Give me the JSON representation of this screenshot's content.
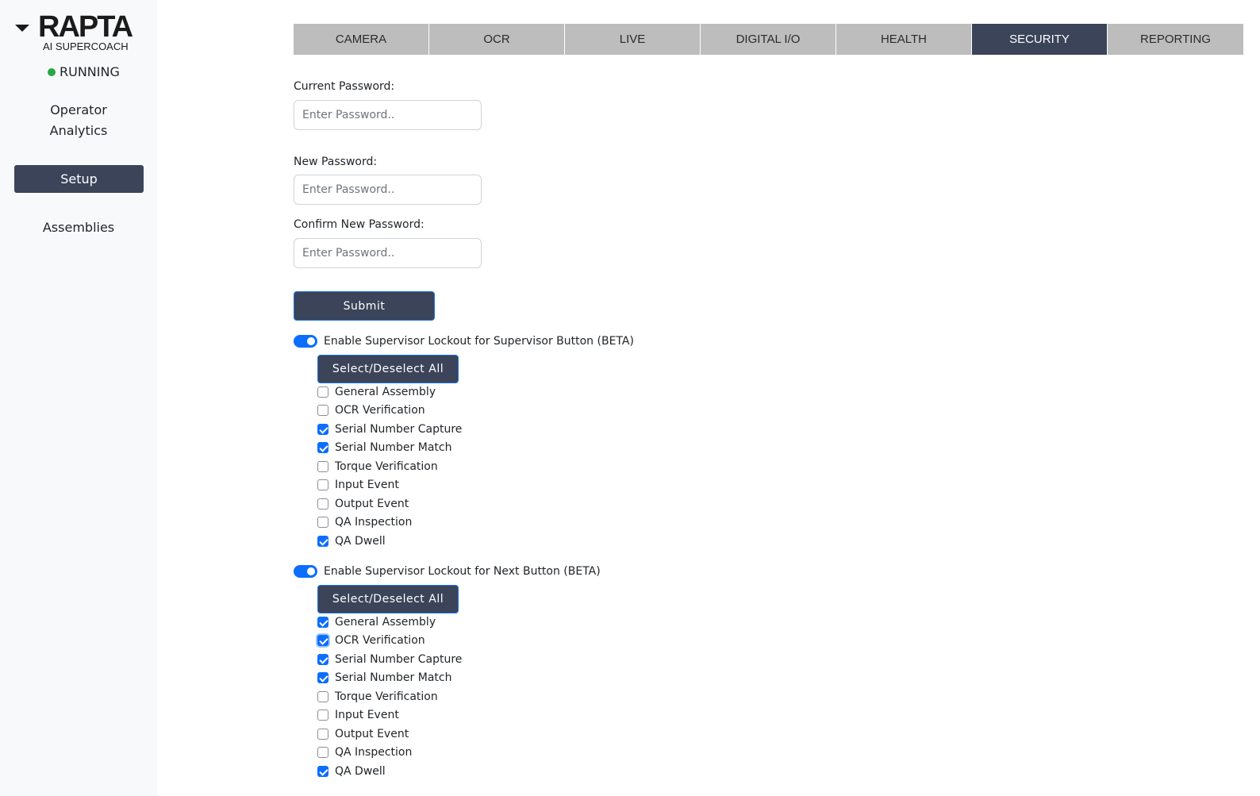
{
  "brand": {
    "logo": "RAPTA",
    "subtitle": "AI SUPERCOACH",
    "status": "RUNNING",
    "status_color": "#28a745"
  },
  "sidebar": {
    "operator_analytics_line1": "Operator",
    "operator_analytics_line2": "Analytics",
    "setup": "Setup",
    "assemblies": "Assemblies"
  },
  "tabs": [
    {
      "label": "CAMERA",
      "active": false
    },
    {
      "label": "OCR",
      "active": false
    },
    {
      "label": "LIVE",
      "active": false
    },
    {
      "label": "DIGITAL I/O",
      "active": false
    },
    {
      "label": "HEALTH",
      "active": false
    },
    {
      "label": "SECURITY",
      "active": true
    },
    {
      "label": "REPORTING",
      "active": false
    }
  ],
  "form": {
    "current_label": "Current Password:",
    "new_label": "New Password:",
    "confirm_label": "Confirm New Password:",
    "placeholder": "Enter Password..",
    "submit": "Submit"
  },
  "lockout_supervisor": {
    "enabled": true,
    "label": "Enable Supervisor Lockout for Supervisor Button (BETA)",
    "select_all": "Select/Deselect All",
    "items": [
      {
        "label": "General Assembly",
        "checked": false
      },
      {
        "label": "OCR Verification",
        "checked": false
      },
      {
        "label": "Serial Number Capture",
        "checked": true
      },
      {
        "label": "Serial Number Match",
        "checked": true
      },
      {
        "label": "Torque Verification",
        "checked": false
      },
      {
        "label": "Input Event",
        "checked": false
      },
      {
        "label": "Output Event",
        "checked": false
      },
      {
        "label": "QA Inspection",
        "checked": false
      },
      {
        "label": "QA Dwell",
        "checked": true
      }
    ]
  },
  "lockout_next": {
    "enabled": true,
    "label": "Enable Supervisor Lockout for Next Button (BETA)",
    "select_all": "Select/Deselect All",
    "items": [
      {
        "label": "General Assembly",
        "checked": true
      },
      {
        "label": "OCR Verification",
        "checked": true
      },
      {
        "label": "Serial Number Capture",
        "checked": true
      },
      {
        "label": "Serial Number Match",
        "checked": true
      },
      {
        "label": "Torque Verification",
        "checked": false
      },
      {
        "label": "Input Event",
        "checked": false
      },
      {
        "label": "Output Event",
        "checked": false
      },
      {
        "label": "QA Inspection",
        "checked": false
      },
      {
        "label": "QA Dwell",
        "checked": true
      }
    ]
  }
}
